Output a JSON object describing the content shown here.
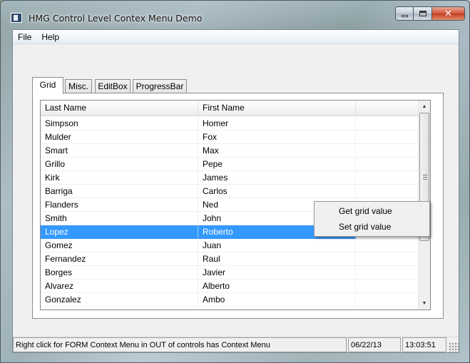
{
  "window": {
    "title": "HMG Control Level Contex Menu Demo",
    "minimize_glyph": "",
    "maximize_glyph": "",
    "close_glyph": "✕"
  },
  "menu": {
    "items": [
      {
        "label": "File"
      },
      {
        "label": "Help"
      }
    ]
  },
  "tabs": [
    {
      "label": "Grid",
      "active": true
    },
    {
      "label": "Misc."
    },
    {
      "label": "EditBox"
    },
    {
      "label": "ProgressBar"
    }
  ],
  "grid": {
    "columns": [
      "Last Name",
      "First Name",
      ""
    ],
    "selected_row": 8,
    "rows": [
      [
        "Simpson",
        "Homer",
        ""
      ],
      [
        "Mulder",
        "Fox",
        ""
      ],
      [
        "Smart",
        "Max",
        ""
      ],
      [
        "Grillo",
        "Pepe",
        ""
      ],
      [
        "Kirk",
        "James",
        ""
      ],
      [
        "Barriga",
        "Carlos",
        ""
      ],
      [
        "Flanders",
        "Ned",
        ""
      ],
      [
        "Smith",
        "John",
        ""
      ],
      [
        "Lopez",
        "Roberto",
        ""
      ],
      [
        "Gomez",
        "Juan",
        ""
      ],
      [
        "Fernandez",
        "Raul",
        ""
      ],
      [
        "Borges",
        "Javier",
        ""
      ],
      [
        "Alvarez",
        "Alberto",
        ""
      ],
      [
        "Gonzalez",
        "Ambo",
        ""
      ]
    ],
    "scroll_up_glyph": "▲",
    "scroll_down_glyph": "▼"
  },
  "context_menu": {
    "items": [
      {
        "label": "Get grid value"
      },
      {
        "label": "Set grid value"
      }
    ]
  },
  "status": {
    "message": "Right click for FORM Context Menu in OUT of controls has Context Menu",
    "date": "06/22/13",
    "time": "13:03:51"
  },
  "colors": {
    "selection": "#3399ff",
    "close_button": "#c23d22"
  }
}
